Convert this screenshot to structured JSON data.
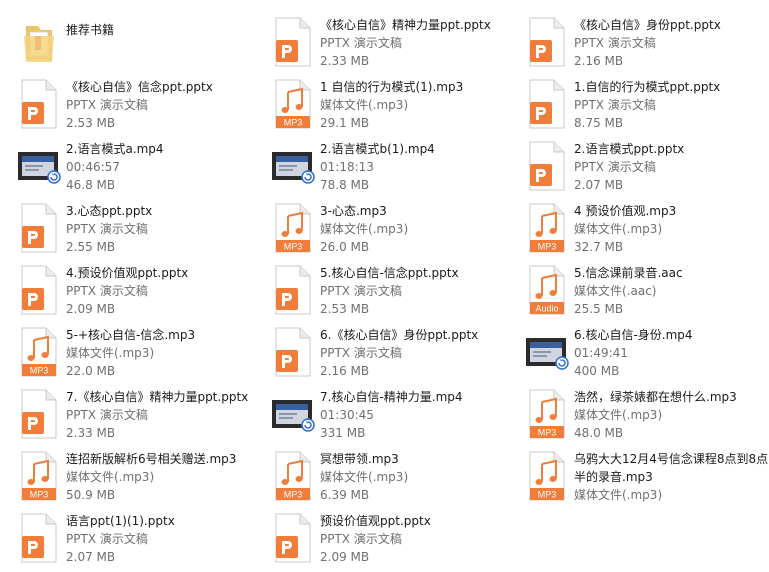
{
  "colors": {
    "accent": "#F07D3A",
    "page_fold": "#F5C7A6",
    "text": "#1a1a1a",
    "sub": "#707070"
  },
  "files": [
    {
      "name": "推荐书籍",
      "lines": [],
      "icon": "folder-icon",
      "col": 0,
      "row": 0
    },
    {
      "name": "《核心自信》精神力量ppt.pptx",
      "lines": [
        "PPTX 演示文稿",
        "2.33 MB"
      ],
      "icon": "pptx-icon",
      "col": 1,
      "row": 0
    },
    {
      "name": "《核心自信》身份ppt.pptx",
      "lines": [
        "PPTX 演示文稿",
        "2.16 MB"
      ],
      "icon": "pptx-icon",
      "col": 2,
      "row": 0
    },
    {
      "name": "《核心自信》信念ppt.pptx",
      "lines": [
        "PPTX 演示文稿",
        "2.53 MB"
      ],
      "icon": "pptx-icon",
      "col": 0,
      "row": 1
    },
    {
      "name": "1 自信的行为模式(1).mp3",
      "lines": [
        "媒体文件(.mp3)",
        "29.1 MB"
      ],
      "icon": "mp3-icon",
      "badge": "MP3",
      "col": 1,
      "row": 1
    },
    {
      "name": "1.自信的行为模式ppt.pptx",
      "lines": [
        "PPTX 演示文稿",
        "8.75 MB"
      ],
      "icon": "pptx-icon",
      "col": 2,
      "row": 1
    },
    {
      "name": "2.语言模式a.mp4",
      "lines": [
        "00:46:57",
        "46.8 MB"
      ],
      "icon": "video-icon",
      "col": 0,
      "row": 2
    },
    {
      "name": "2.语言模式b(1).mp4",
      "lines": [
        "01:18:13",
        "78.8 MB"
      ],
      "icon": "video-icon",
      "col": 1,
      "row": 2
    },
    {
      "name": "2.语言模式ppt.pptx",
      "lines": [
        "PPTX 演示文稿",
        "2.07 MB"
      ],
      "icon": "pptx-icon",
      "col": 2,
      "row": 2
    },
    {
      "name": "3.心态ppt.pptx",
      "lines": [
        "PPTX 演示文稿",
        "2.55 MB"
      ],
      "icon": "pptx-icon",
      "col": 0,
      "row": 3
    },
    {
      "name": "3-心态.mp3",
      "lines": [
        "媒体文件(.mp3)",
        "26.0 MB"
      ],
      "icon": "mp3-icon",
      "badge": "MP3",
      "col": 1,
      "row": 3
    },
    {
      "name": "4 预设价值观.mp3",
      "lines": [
        "媒体文件(.mp3)",
        "32.7 MB"
      ],
      "icon": "mp3-icon",
      "badge": "MP3",
      "col": 2,
      "row": 3
    },
    {
      "name": "4.预设价值观ppt.pptx",
      "lines": [
        "PPTX 演示文稿",
        "2.09 MB"
      ],
      "icon": "pptx-icon",
      "col": 0,
      "row": 4
    },
    {
      "name": "5.核心自信-信念ppt.pptx",
      "lines": [
        "PPTX 演示文稿",
        "2.53 MB"
      ],
      "icon": "pptx-icon",
      "col": 1,
      "row": 4
    },
    {
      "name": "5.信念课前录音.aac",
      "lines": [
        "媒体文件(.aac)",
        "25.5 MB"
      ],
      "icon": "aac-icon",
      "badge": "Audio",
      "col": 2,
      "row": 4
    },
    {
      "name": "5-+核心自信-信念.mp3",
      "lines": [
        "媒体文件(.mp3)",
        "22.0 MB"
      ],
      "icon": "mp3-icon",
      "badge": "MP3",
      "col": 0,
      "row": 5
    },
    {
      "name": "6.《核心自信》身份ppt.pptx",
      "lines": [
        "PPTX 演示文稿",
        "2.16 MB"
      ],
      "icon": "pptx-icon",
      "col": 1,
      "row": 5
    },
    {
      "name": "6.核心自信-身份.mp4",
      "lines": [
        "01:49:41",
        "400 MB"
      ],
      "icon": "video-icon",
      "col": 2,
      "row": 5
    },
    {
      "name": "7.《核心自信》精神力量ppt.pptx",
      "lines": [
        "PPTX 演示文稿",
        "2.33 MB"
      ],
      "icon": "pptx-icon",
      "col": 0,
      "row": 6
    },
    {
      "name": "7.核心自信-精神力量.mp4",
      "lines": [
        "01:30:45",
        "331 MB"
      ],
      "icon": "video-icon",
      "col": 1,
      "row": 6
    },
    {
      "name": "浩然，绿茶婊都在想什么.mp3",
      "lines": [
        "媒体文件(.mp3)",
        "48.0 MB"
      ],
      "icon": "mp3-icon",
      "badge": "MP3",
      "col": 2,
      "row": 6
    },
    {
      "name": "连招新版解析6号相关赠送.mp3",
      "lines": [
        "媒体文件(.mp3)",
        "50.9 MB"
      ],
      "icon": "mp3-icon",
      "badge": "MP3",
      "col": 0,
      "row": 7
    },
    {
      "name": "冥想带领.mp3",
      "lines": [
        "媒体文件(.mp3)",
        "6.39 MB"
      ],
      "icon": "mp3-icon",
      "badge": "MP3",
      "col": 1,
      "row": 7
    },
    {
      "name": "乌鸦大大12月4号信念课程8点到8点半的录音.mp3",
      "lines": [
        "媒体文件(.mp3)"
      ],
      "icon": "mp3-icon",
      "badge": "MP3",
      "wrap": true,
      "col": 2,
      "row": 7
    },
    {
      "name": "语言ppt(1)(1).pptx",
      "lines": [
        "PPTX 演示文稿",
        "2.07 MB"
      ],
      "icon": "pptx-icon",
      "col": 0,
      "row": 8
    },
    {
      "name": "预设价值观ppt.pptx",
      "lines": [
        "PPTX 演示文稿",
        "2.09 MB"
      ],
      "icon": "pptx-icon",
      "col": 1,
      "row": 8
    }
  ]
}
